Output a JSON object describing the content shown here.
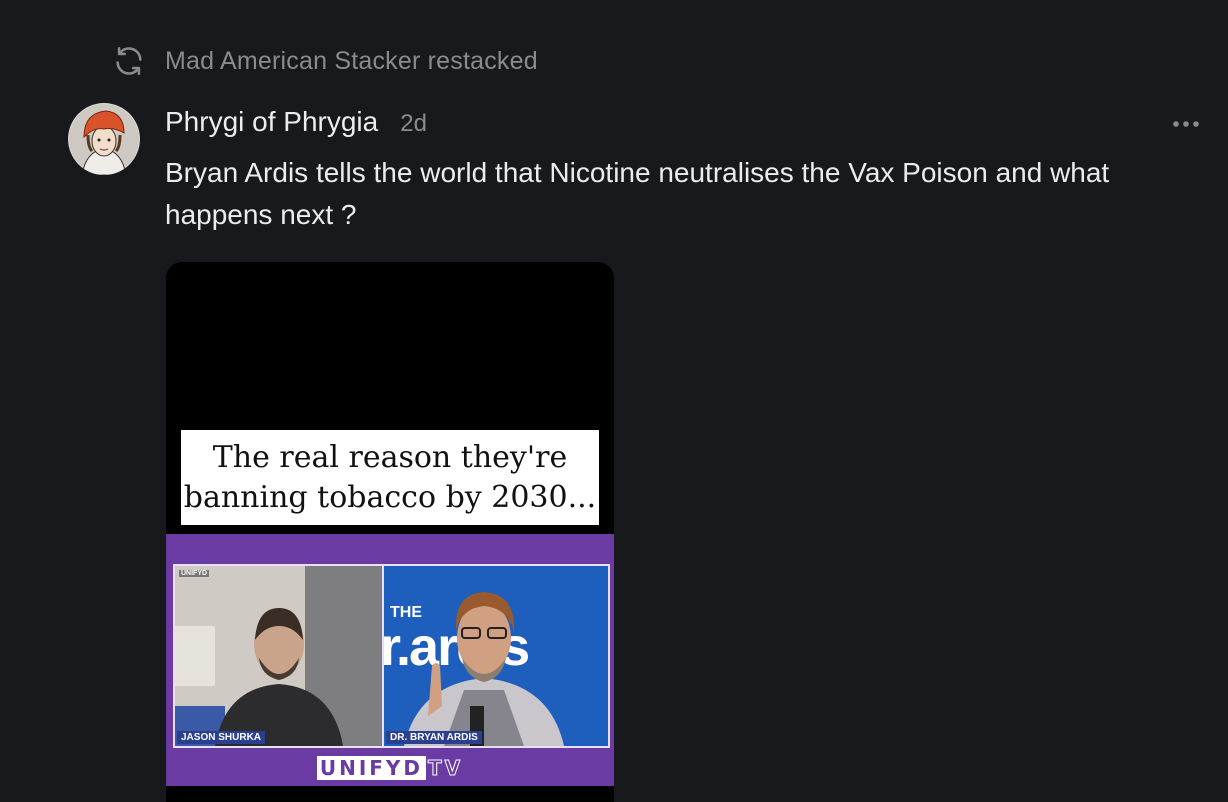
{
  "restack": {
    "icon": "restack-icon",
    "text": "Mad American Stacker restacked"
  },
  "post": {
    "author": "Phrygi of Phrygia",
    "time": "2d",
    "body": "Bryan Ardis tells the world that Nicotine neutralises the Vax Poison and what happens next ?",
    "more_icon": "more-horizontal-icon"
  },
  "video": {
    "caption_line1": "The real reason they're",
    "caption_line2": "banning tobacco by 2030...",
    "left_name": "JASON SHURKA",
    "right_name": "DR. BRYAN ARDIS",
    "brand_a": "UNIFYD",
    "brand_b": "TV",
    "corner_logo": "UNIFYD",
    "the_label": "THE",
    "show_title": "r.ardis"
  },
  "colors": {
    "background": "#18191c",
    "text_primary": "#ececee",
    "text_secondary": "#8a8b8f",
    "brand_purple": "#6a3ca3"
  }
}
